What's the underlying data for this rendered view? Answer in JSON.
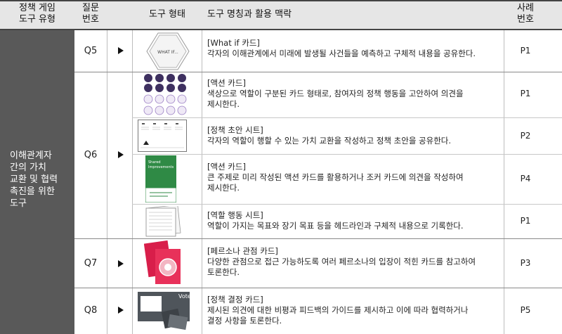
{
  "header": {
    "type_line1": "정책 게임",
    "type_line2": "도구 유형",
    "q_line1": "질문",
    "q_line2": "번호",
    "form": "도구 형태",
    "name": "도구 명칭과 활용 맥락",
    "case_line1": "사례",
    "case_line2": "번호"
  },
  "category": {
    "line1": "이해관계자",
    "line2": "간의 가치",
    "line3": "교환 및 협력",
    "line4": "촉진을 위한",
    "line5": "도구"
  },
  "questions": [
    "Q5",
    "Q6",
    "Q7",
    "Q8"
  ],
  "rows": [
    {
      "title": "[What if 카드]",
      "desc1": "각자의 이해관계에서 미래에 발생될 사건들을 예측하고 구체적 내용을 공유한다.",
      "desc2": "",
      "case": "P1",
      "thumb_label": "WHAT IF..."
    },
    {
      "title": "[액션 카드]",
      "desc1": "색상으로 역할이 구분된 카드 형태로, 참여자의 정책 행동을 고안하여 의견을",
      "desc2": "제시한다.",
      "case": "P1"
    },
    {
      "title": "[정책 초안 시트]",
      "desc1": "각자의 역할이 행할 수 있는 가치 교환을 작성하고 정책 초안을 공유한다.",
      "desc2": "",
      "case": "P2"
    },
    {
      "title": "[액션 카드]",
      "desc1": "큰 주제로 미리 작성된 액션 카드를 활용하거나 조커 카드에 의견을 작성하여",
      "desc2": "제시한다.",
      "case": "P4",
      "thumb_label1": "Shared",
      "thumb_label2": "Improvements"
    },
    {
      "title": "[역할 행동 시트]",
      "desc1": "역할이 가지는 목표와 장기 목표 등을 헤드라인과 구체적 내용으로 기록한다.",
      "desc2": "",
      "case": "P1"
    },
    {
      "title": "[페르소나 관점 카드]",
      "desc1": "다양한 관점으로 접근 가능하도록 여러 페르소나의 입장이 적힌 카드를 참고하여",
      "desc2": "토론한다.",
      "case": "P3"
    },
    {
      "title": "[정책 결정 카드]",
      "desc1": "제시된 의견에 대한 비평과 피드백의 가이드를 제시하고 이에 따라 협력하거나",
      "desc2": "결정 사항을 토론한다.",
      "case": "P5",
      "thumb_label": "Vote"
    }
  ]
}
